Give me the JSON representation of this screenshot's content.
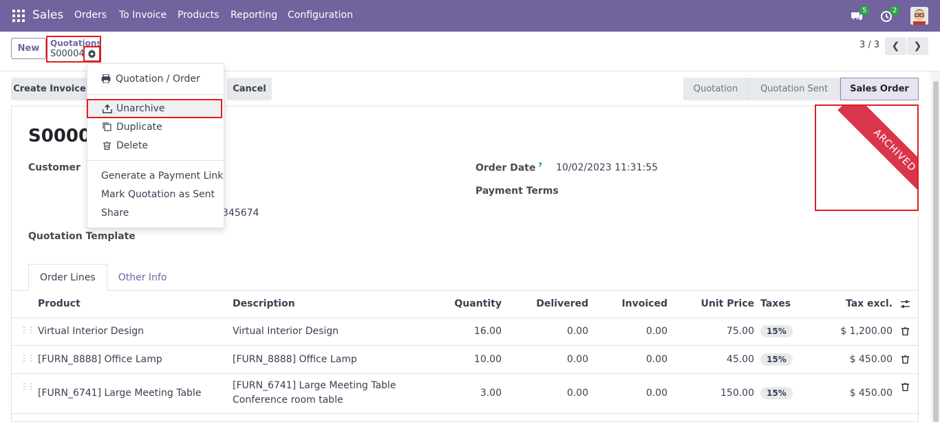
{
  "topbar": {
    "app_name": "Sales",
    "menu": [
      "Orders",
      "To Invoice",
      "Products",
      "Reporting",
      "Configuration"
    ],
    "chat_count": "5",
    "activity_count": "2",
    "bg_color": "#71639e"
  },
  "control_panel": {
    "new_label": "New",
    "breadcrumb_parent": "Quotations",
    "breadcrumb_current": "S00004",
    "pager": "3 / 3"
  },
  "status_bar": {
    "buttons": [
      "Create Invoice",
      "Cancel"
    ],
    "stages": [
      "Quotation",
      "Quotation Sent",
      "Sales Order"
    ],
    "active_stage": "Sales Order"
  },
  "action_menu": {
    "items": [
      {
        "label": "Quotation / Order",
        "icon": "print-icon"
      },
      {
        "label": "Unarchive",
        "icon": "upload-icon"
      },
      {
        "label": "Duplicate",
        "icon": "copy-icon"
      },
      {
        "label": "Delete",
        "icon": "trash-icon"
      },
      {
        "label": "Generate a Payment Link"
      },
      {
        "label": "Mark Quotation as Sent"
      },
      {
        "label": "Share"
      }
    ]
  },
  "form": {
    "name_partial": "S00004",
    "ribbon": "ARCHIVED",
    "customer_label": "Customer",
    "phone_partial": "345674",
    "template_label": "Quotation Template",
    "order_date_label": "Order Date",
    "order_date_help": "?",
    "order_date": "10/02/2023 11:31:55",
    "payment_terms_label": "Payment Terms"
  },
  "tabs": [
    "Order Lines",
    "Other Info"
  ],
  "table": {
    "headers": [
      "Product",
      "Description",
      "Quantity",
      "Delivered",
      "Invoiced",
      "Unit Price",
      "Taxes",
      "Tax excl."
    ],
    "rows": [
      {
        "product": "Virtual Interior Design",
        "description": "Virtual Interior Design",
        "description2": "",
        "quantity": "16.00",
        "delivered": "0.00",
        "invoiced": "0.00",
        "unit_price": "75.00",
        "taxes": "15%",
        "subtotal": "$ 1,200.00"
      },
      {
        "product": "[FURN_8888] Office Lamp",
        "description": "[FURN_8888] Office Lamp",
        "description2": "",
        "quantity": "10.00",
        "delivered": "0.00",
        "invoiced": "0.00",
        "unit_price": "45.00",
        "taxes": "15%",
        "subtotal": "$ 450.00"
      },
      {
        "product": "[FURN_6741] Large Meeting Table",
        "description": "[FURN_6741] Large Meeting Table",
        "description2": "Conference room table",
        "quantity": "3.00",
        "delivered": "0.00",
        "invoiced": "0.00",
        "unit_price": "150.00",
        "taxes": "15%",
        "subtotal": "$ 450.00"
      }
    ]
  },
  "colors": {
    "accent": "#71639e",
    "highlight": "#e11d1d",
    "ribbon": "#d9364b"
  }
}
